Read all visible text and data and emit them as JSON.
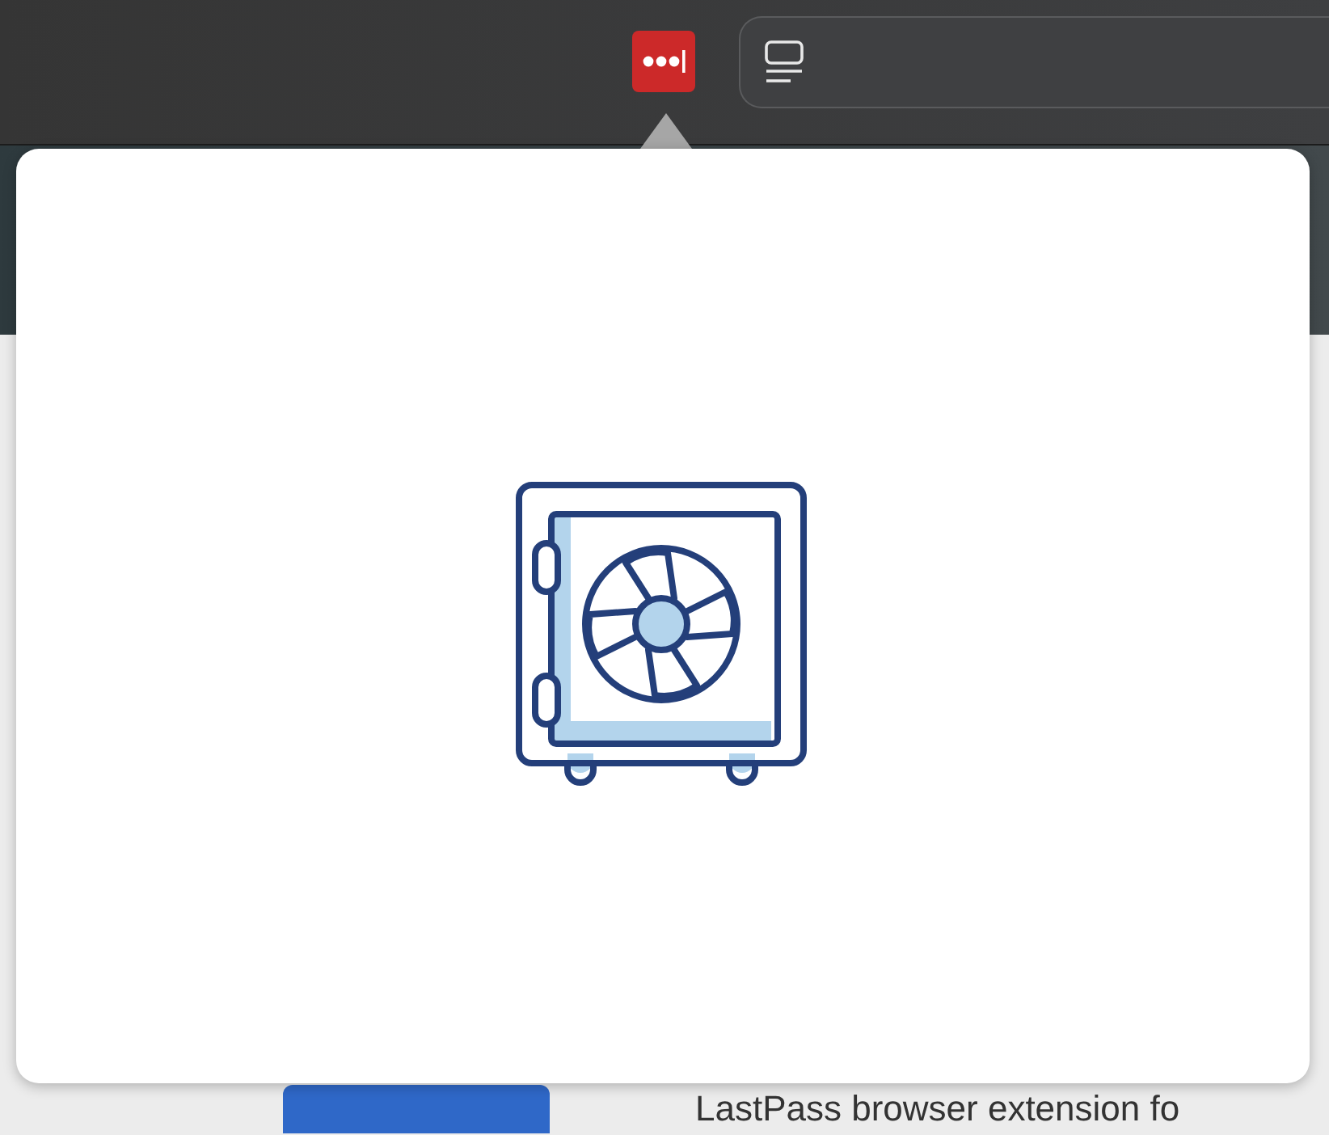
{
  "page": {
    "heading": "LastPass browser extension fo"
  }
}
